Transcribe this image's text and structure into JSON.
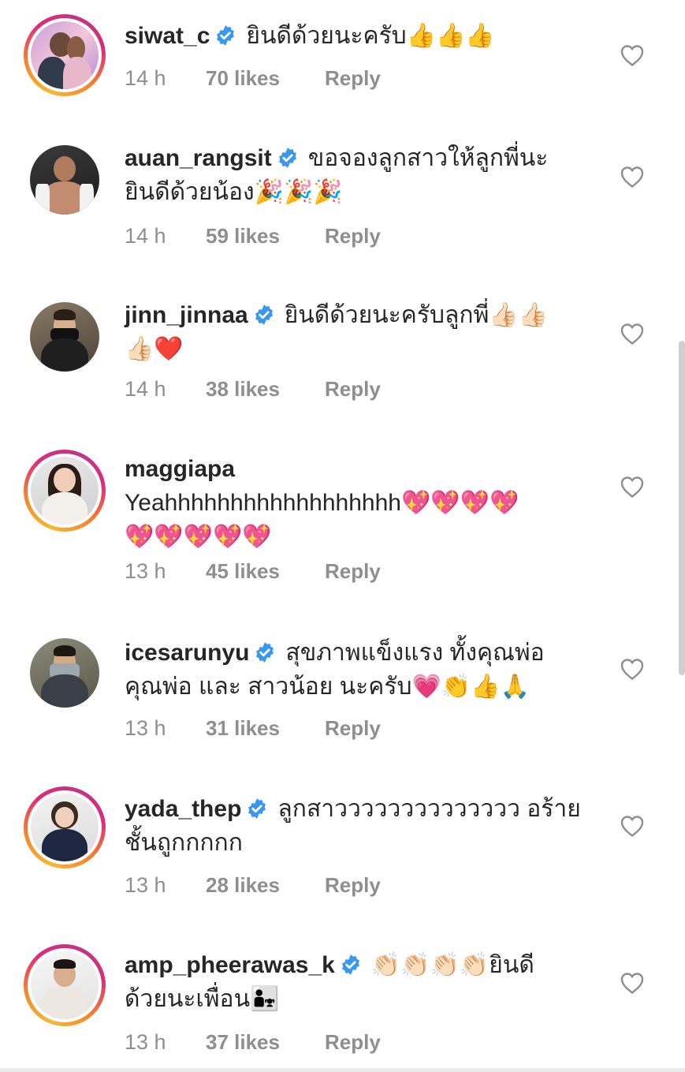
{
  "comments": [
    {
      "username": "siwat_c",
      "verified": true,
      "text_lines": [
        "ยินดีด้วยนะครับ👍👍👍"
      ],
      "time": "14 h",
      "likes": "70 likes",
      "reply": "Reply",
      "story_ring": true
    },
    {
      "username": "auan_rangsit",
      "verified": true,
      "text_lines": [
        "ขอจองลูกสาวให้ลูกพี่นะ",
        "ยินดีด้วยน้อง🎉🎉🎉"
      ],
      "time": "14 h",
      "likes": "59 likes",
      "reply": "Reply",
      "story_ring": false
    },
    {
      "username": "jinn_jinnaa",
      "verified": true,
      "text_lines": [
        "ยินดีด้วยนะครับลูกพี่👍🏻👍🏻",
        "👍🏻❤️"
      ],
      "time": "14 h",
      "likes": "38 likes",
      "reply": "Reply",
      "story_ring": false
    },
    {
      "username": "maggiapa",
      "verified": false,
      "text_lines": [
        "Yeahhhhhhhhhhhhhhhhhh💖💖💖💖",
        "💖💖💖💖💖"
      ],
      "time": "13 h",
      "likes": "45 likes",
      "reply": "Reply",
      "story_ring": true
    },
    {
      "username": "icesarunyu",
      "verified": true,
      "text_lines": [
        "สุขภาพแข็งแรง ทั้งคุณพ่อ",
        "คุณพ่อ และ สาวน้อย นะครับ💗👏👍🙏"
      ],
      "time": "13 h",
      "likes": "31 likes",
      "reply": "Reply",
      "story_ring": false
    },
    {
      "username": "yada_thep",
      "verified": true,
      "text_lines": [
        "ลูกสาวววววววววววววว อร้าย",
        "ชั้นถูกกกกก"
      ],
      "time": "13 h",
      "likes": "28 likes",
      "reply": "Reply",
      "story_ring": true
    },
    {
      "username": "amp_pheerawas_k",
      "verified": true,
      "text_lines": [
        "👏🏻👏🏻👏🏻👏🏻ยินดี",
        "ด้วยนะเพื่อน👨‍👧"
      ],
      "time": "13 h",
      "likes": "37 likes",
      "reply": "Reply",
      "story_ring": true
    }
  ],
  "colors": {
    "text": "#262626",
    "meta": "#8e8e8e",
    "verified": "#3897f0",
    "heart_outline": "#8e8e8e"
  },
  "icons": {
    "verified": "verified-badge-icon",
    "like": "heart-outline-icon"
  }
}
